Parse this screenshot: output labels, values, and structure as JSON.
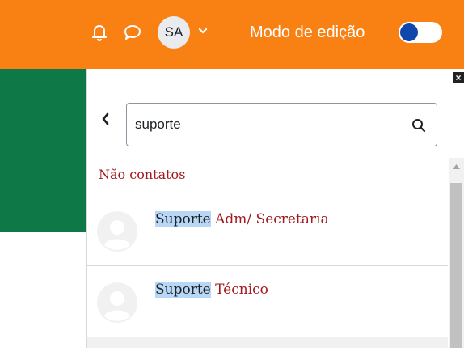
{
  "header": {
    "avatar_initials": "SA",
    "edit_mode_label": "Modo de edição",
    "edit_mode_on": true,
    "icons": [
      "bell-icon",
      "chat-icon",
      "chevron-down-icon"
    ],
    "colors": {
      "bar": "#f98012",
      "toggle_knob": "#0f47ad"
    }
  },
  "messaging": {
    "close_label": "×",
    "search": {
      "value": "suporte",
      "placeholder": ""
    },
    "section_title": "Não contatos",
    "contacts": [
      {
        "highlight": "Suporte",
        "rest": " Adm/ Secretaria"
      },
      {
        "highlight": "Suporte",
        "rest": " Técnico"
      }
    ],
    "colors": {
      "link": "#a11b20",
      "highlight": "#b8d7f5"
    }
  },
  "sidebar": {
    "color": "#0f7847"
  }
}
